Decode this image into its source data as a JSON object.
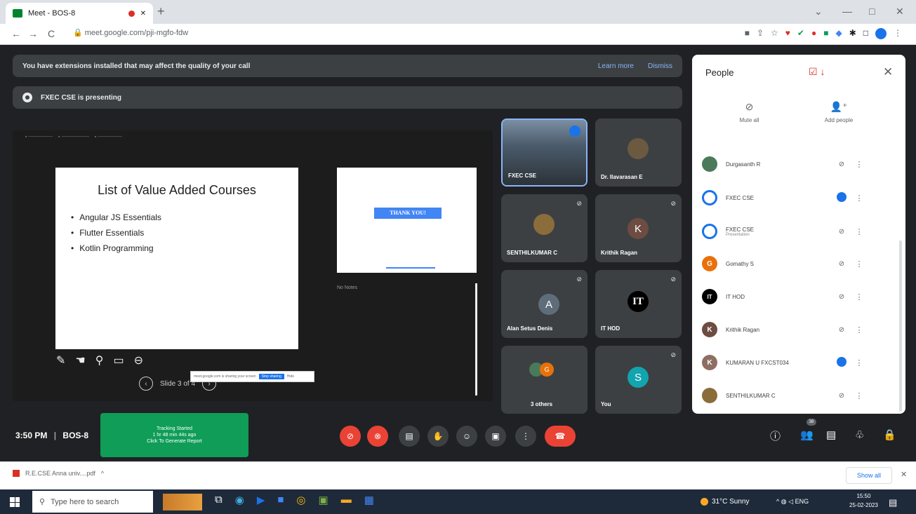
{
  "browser": {
    "tab_title": "Meet - BOS-8",
    "url": "meet.google.com/pji-mgfo-fdw",
    "new_tab": "+",
    "back": "←",
    "forward": "→",
    "reload": "C",
    "minimize": "—",
    "maximize": "□",
    "close": "✕",
    "tab_menu": "⌄"
  },
  "banners": {
    "extensions_text": "You have extensions installed that may affect the quality of your call",
    "learn_more": "Learn more",
    "dismiss": "Dismiss",
    "presenting_text": "FXEC CSE is presenting"
  },
  "slide": {
    "title": "List of Value Added Courses",
    "items": [
      "Angular JS Essentials",
      "Flutter Essentials",
      "Kotlin Programming"
    ],
    "next_slide_text": "THANK YOU!",
    "notes_label": "No Notes",
    "nav_label": "Slide 3 of 4",
    "share_bar_text": "meet.google.com is sharing your screen",
    "share_bar_stop": "Stop sharing",
    "share_bar_hide": "Hide"
  },
  "tiles": [
    {
      "name": "FXEC CSE"
    },
    {
      "name": "Dr. Ilavarasan E"
    },
    {
      "name": "SENTHILKUMAR C"
    },
    {
      "name": "Krithik Ragan",
      "initial": "K"
    },
    {
      "name": "Alan Setus Denis",
      "initial": "A"
    },
    {
      "name": "IT HOD",
      "initial": "IT"
    },
    {
      "name": "3 others",
      "initial": "G"
    },
    {
      "name": "You",
      "initial": "S"
    }
  ],
  "people": {
    "title": "People",
    "mute_all": "Mute all",
    "add_people": "Add people",
    "list": [
      {
        "name": "Durgasanth R",
        "sub": ""
      },
      {
        "name": "FXEC CSE",
        "sub": ""
      },
      {
        "name": "FXEC CSE",
        "sub": "Presentation"
      },
      {
        "name": "Gomathy S",
        "sub": "",
        "initial": "G"
      },
      {
        "name": "IT HOD",
        "sub": "",
        "initial": "IT"
      },
      {
        "name": "Krithik Ragan",
        "sub": "",
        "initial": "K"
      },
      {
        "name": "KUMARAN U FXCST034",
        "sub": "",
        "initial": "K"
      },
      {
        "name": "SENTHILKUMAR C",
        "sub": ""
      }
    ]
  },
  "controls": {
    "time": "3:50 PM",
    "meeting_code": "BOS-8",
    "tracking_line1": "Tracking Started",
    "tracking_line2": "1 hr 48 min 44s ago",
    "tracking_line3": "Click To Generate Report",
    "people_count": "38"
  },
  "downloads": {
    "file": "R.E.CSE Anna univ....pdf",
    "show_all": "Show all"
  },
  "taskbar": {
    "search_placeholder": "Type here to search",
    "weather": "31°C Sunny",
    "lang": "ENG",
    "time": "15:50",
    "date": "25-02-2023"
  },
  "colors": {
    "accent": "#1a73e8",
    "danger": "#ea4335",
    "tracking": "#0f9d58"
  }
}
